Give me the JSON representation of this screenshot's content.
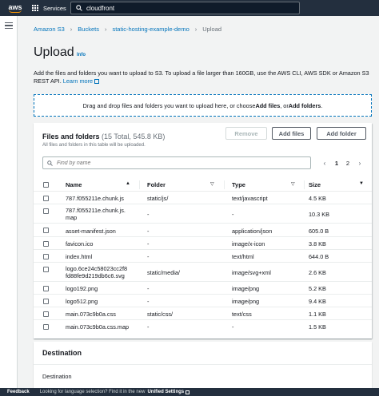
{
  "topnav": {
    "logo_text": "aws",
    "services_label": "Services",
    "search_value": "cloudfront"
  },
  "breadcrumb": [
    {
      "label": "Amazon S3",
      "link": true
    },
    {
      "label": "Buckets",
      "link": true
    },
    {
      "label": "static-hosting-example-demo",
      "link": true
    },
    {
      "label": "Upload",
      "link": false
    }
  ],
  "page": {
    "title": "Upload",
    "info": "Info",
    "desc_line1": "Add the files and folders you want to upload to S3. To upload a file larger than 160GB, use the AWS CLI, AWS SDK or Amazon",
    "desc_line2": "S3 REST API.",
    "learn_more": "Learn more"
  },
  "dropzone": {
    "prefix": "Drag and drop files and folders you want to upload here, or choose ",
    "add_files": "Add files",
    "or": ", or ",
    "add_folders": "Add folders",
    "suffix": "."
  },
  "files_panel": {
    "title": "Files and folders",
    "count": "(15 Total, 545.8 KB)",
    "subtitle": "All files and folders in this table will be uploaded.",
    "remove_label": "Remove",
    "add_files_label": "Add files",
    "add_folder_label": "Add folder",
    "filter_placeholder": "Find by name",
    "pager": {
      "prev": "‹",
      "pages": [
        "1",
        "2"
      ],
      "next": "›"
    },
    "columns": [
      "Name",
      "Folder",
      "Type",
      "Size"
    ],
    "rows": [
      {
        "name": "787.f055211e.chunk.js",
        "folder": "static/js/",
        "type": "text/javascript",
        "size": "4.5 KB"
      },
      {
        "name": "787.f055211e.chunk.js.",
        "name2": "map",
        "folder": "-",
        "type": "-",
        "size": "10.3 KB"
      },
      {
        "name": "asset-manifest.json",
        "folder": "-",
        "type": "application/json",
        "size": "605.0 B"
      },
      {
        "name": "favicon.ico",
        "folder": "-",
        "type": "image/x-icon",
        "size": "3.8 KB"
      },
      {
        "name": "index.html",
        "folder": "-",
        "type": "text/html",
        "size": "644.0 B"
      },
      {
        "name": "logo.6ce24c58023cc2f8",
        "name2": "fd88fe9d219db6c6.svg",
        "folder": "static/media/",
        "type": "image/svg+xml",
        "size": "2.6 KB"
      },
      {
        "name": "logo192.png",
        "folder": "-",
        "type": "image/png",
        "size": "5.2 KB"
      },
      {
        "name": "logo512.png",
        "folder": "-",
        "type": "image/png",
        "size": "9.4 KB"
      },
      {
        "name": "main.073c9b0a.css",
        "folder": "static/css/",
        "type": "text/css",
        "size": "1.1 KB"
      },
      {
        "name": "main.073c9b0a.css.map",
        "folder": "-",
        "type": "-",
        "size": "1.5 KB"
      }
    ]
  },
  "destination": {
    "title": "Destination",
    "label": "Destination"
  },
  "footer": {
    "feedback": "Feedback",
    "message": "Looking for language selection? Find it in the new",
    "settings_link": "Unified Settings"
  },
  "colors": {
    "nav_bg": "#232f3e",
    "link": "#0073bb",
    "accent": "#ff9900"
  }
}
